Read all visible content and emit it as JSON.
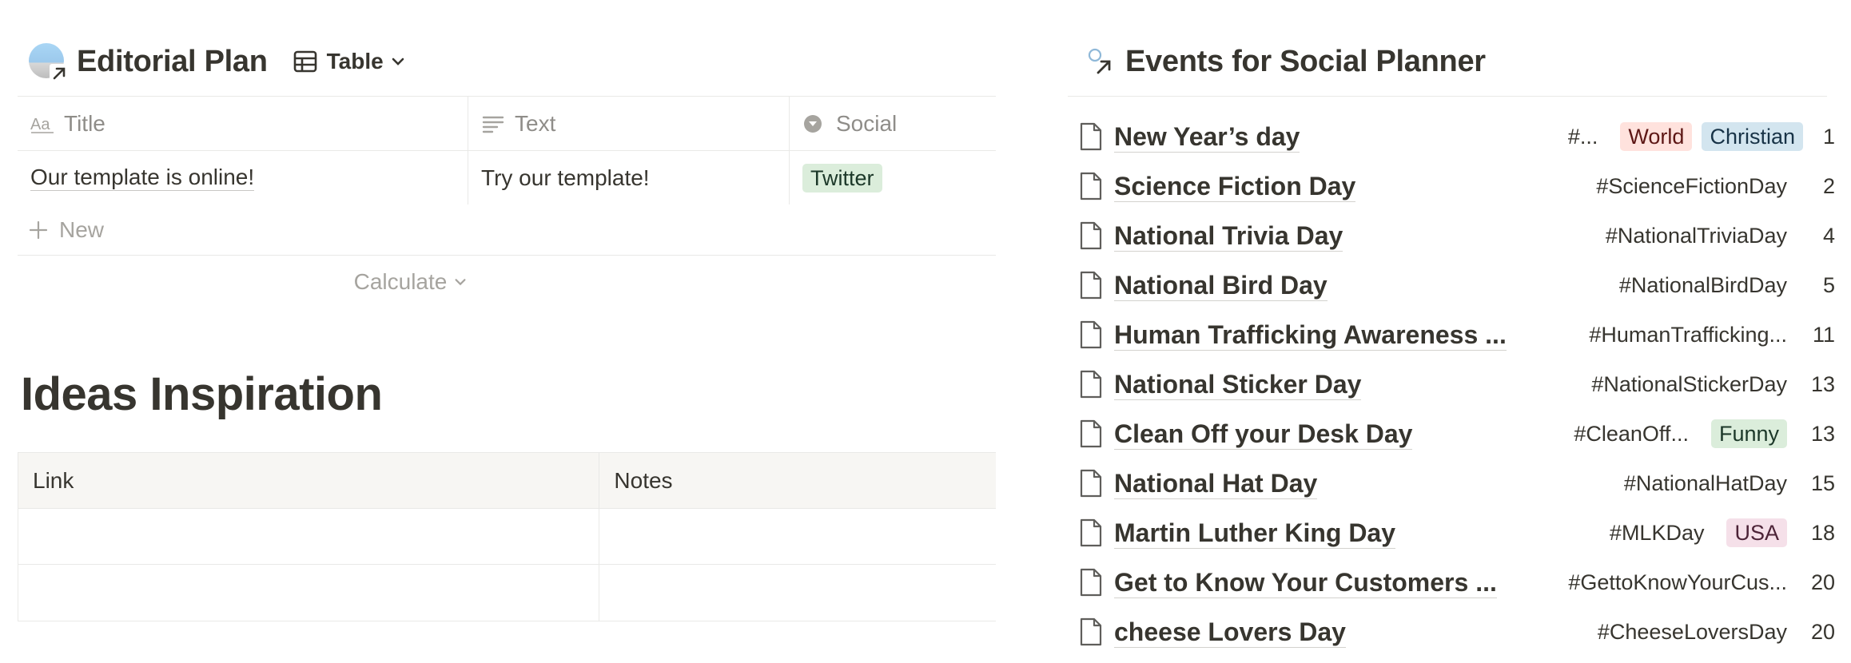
{
  "editorial": {
    "title": "Editorial Plan",
    "view_label": "Table",
    "columns": [
      "Title",
      "Text",
      "Social"
    ],
    "rows": [
      {
        "title": "Our template is online!",
        "text": "Try our template!",
        "social": "Twitter"
      }
    ],
    "new_label": "New",
    "calculate_label": "Calculate"
  },
  "ideas": {
    "title": "Ideas Inspiration",
    "columns": [
      "Link",
      "Notes"
    ]
  },
  "events": {
    "title": "Events for Social Planner",
    "items": [
      {
        "name": "New Year’s day",
        "hashtag": "#...",
        "tags": [
          {
            "label": "World",
            "color": "red"
          },
          {
            "label": "Christian",
            "color": "blue"
          }
        ],
        "date": "1"
      },
      {
        "name": "Science Fiction Day",
        "hashtag": "#ScienceFictionDay",
        "tags": [],
        "date": "2"
      },
      {
        "name": "National Trivia Day",
        "hashtag": "#NationalTriviaDay",
        "tags": [],
        "date": "4"
      },
      {
        "name": "National Bird Day",
        "hashtag": "#NationalBirdDay",
        "tags": [],
        "date": "5"
      },
      {
        "name": "Human Trafficking Awareness ...",
        "hashtag": "#HumanTrafficking...",
        "tags": [],
        "date": "11"
      },
      {
        "name": "National Sticker Day",
        "hashtag": "#NationalStickerDay",
        "tags": [],
        "date": "13"
      },
      {
        "name": "Clean Off your Desk Day",
        "hashtag": "#CleanOff...",
        "tags": [
          {
            "label": "Funny",
            "color": "green"
          }
        ],
        "date": "13"
      },
      {
        "name": "National Hat Day",
        "hashtag": "#NationalHatDay",
        "tags": [],
        "date": "15"
      },
      {
        "name": "Martin Luther King Day",
        "hashtag": "#MLKDay",
        "tags": [
          {
            "label": "USA",
            "color": "pink"
          }
        ],
        "date": "18"
      },
      {
        "name": "Get to Know Your Customers ...",
        "hashtag": "#GettoKnowYourCus...",
        "tags": [],
        "date": "20"
      },
      {
        "name": "cheese Lovers Day",
        "hashtag": "#CheeseLoversDay",
        "tags": [],
        "date": "20"
      }
    ]
  },
  "colors": {
    "text": "#37352f",
    "muted": "#8f8d89",
    "border": "#e9e9e7",
    "header_bg": "#f7f6f3",
    "tag_green": "#dbeddb",
    "tag_red": "#ffe2dd",
    "tag_blue": "#d3e5ef",
    "tag_pink": "#f5e0e9"
  },
  "icons": {
    "editorial_db": "database-image-icon",
    "view": "table-icon",
    "title_prop": "text-aa-icon",
    "text_prop": "text-lines-icon",
    "social_prop": "select-circle-icon",
    "events_db": "linked-database-icon",
    "event_page": "page-icon"
  }
}
